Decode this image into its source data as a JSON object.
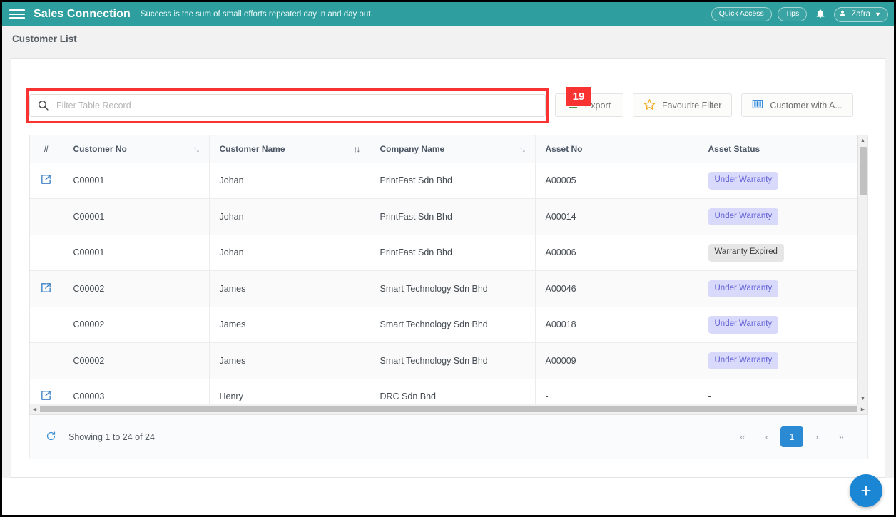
{
  "appbar": {
    "menu_icon": "hamburger-icon",
    "brand": "Sales Connection",
    "tagline": "Success is the sum of small efforts repeated day in and day out.",
    "quick_access": "Quick Access",
    "tips": "Tips",
    "bell_icon": "bell-icon",
    "user_name": "Zafra",
    "caret": "∨",
    "bg_color": "#2e9e9e"
  },
  "page": {
    "title": "Customer List"
  },
  "toolbar": {
    "search_placeholder": "Filter Table Record",
    "search_value": "",
    "highlight_badge": "19",
    "highlight_color": "#f93232",
    "export_label": "Export",
    "favourite_filter_label": "Favourite Filter",
    "customer_with_label": "Customer with A..."
  },
  "table": {
    "columns": [
      {
        "key": "idx",
        "label": "#",
        "sortable": false
      },
      {
        "key": "customer_no",
        "label": "Customer No",
        "sortable": true
      },
      {
        "key": "customer_name",
        "label": "Customer Name",
        "sortable": true
      },
      {
        "key": "company_name",
        "label": "Company Name",
        "sortable": true
      },
      {
        "key": "asset_no",
        "label": "Asset No",
        "sortable": false
      },
      {
        "key": "asset_status",
        "label": "Asset Status",
        "sortable": false
      }
    ],
    "sort_icon": "↑↓",
    "rows": [
      {
        "expand": true,
        "customer_no": "C00001",
        "customer_name": "Johan",
        "company_name": "PrintFast Sdn Bhd",
        "asset_no": "A00005",
        "asset_status": "Under Warranty",
        "status_kind": "warranty"
      },
      {
        "expand": false,
        "customer_no": "C00001",
        "customer_name": "Johan",
        "company_name": "PrintFast Sdn Bhd",
        "asset_no": "A00014",
        "asset_status": "Under Warranty",
        "status_kind": "warranty"
      },
      {
        "expand": false,
        "customer_no": "C00001",
        "customer_name": "Johan",
        "company_name": "PrintFast Sdn Bhd",
        "asset_no": "A00006",
        "asset_status": "Warranty Expired",
        "status_kind": "expired"
      },
      {
        "expand": true,
        "customer_no": "C00002",
        "customer_name": "James",
        "company_name": "Smart Technology Sdn Bhd",
        "asset_no": "A00046",
        "asset_status": "Under Warranty",
        "status_kind": "warranty"
      },
      {
        "expand": false,
        "customer_no": "C00002",
        "customer_name": "James",
        "company_name": "Smart Technology Sdn Bhd",
        "asset_no": "A00018",
        "asset_status": "Under Warranty",
        "status_kind": "warranty"
      },
      {
        "expand": false,
        "customer_no": "C00002",
        "customer_name": "James",
        "company_name": "Smart Technology Sdn Bhd",
        "asset_no": "A00009",
        "asset_status": "Under Warranty",
        "status_kind": "warranty"
      },
      {
        "expand": true,
        "customer_no": "C00003",
        "customer_name": "Henry",
        "company_name": "DRC Sdn Bhd",
        "asset_no": "-",
        "asset_status": "-",
        "status_kind": "plain"
      }
    ]
  },
  "footer": {
    "refresh_icon": "refresh-icon",
    "showing": "Showing 1 to 24 of 24",
    "pager": {
      "first": "«",
      "prev": "‹",
      "current_page": "1",
      "next": "›",
      "last": "»"
    }
  },
  "fab": {
    "label": "+",
    "color": "#1b86d4"
  }
}
